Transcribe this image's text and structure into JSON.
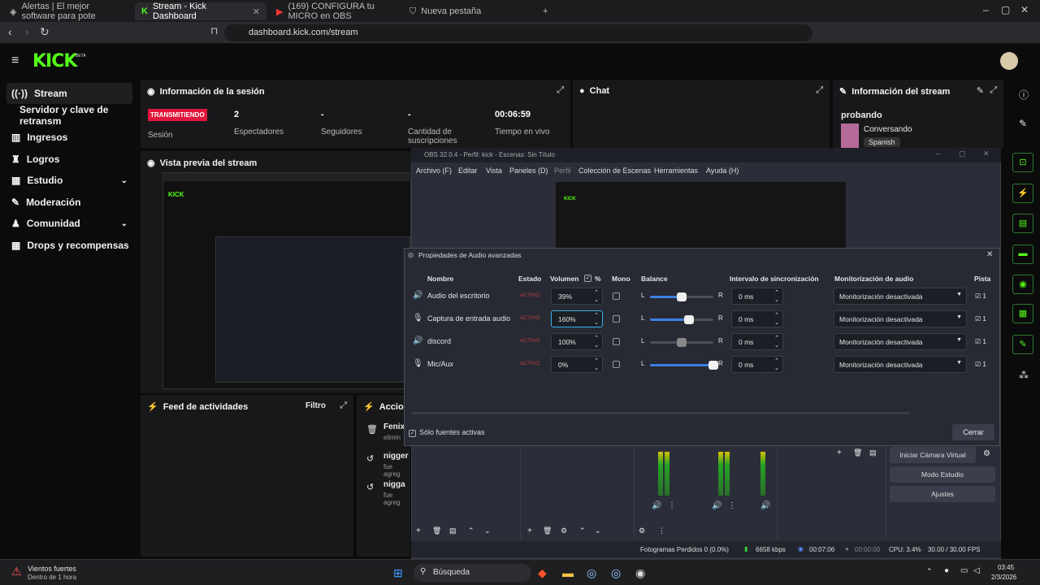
{
  "browser": {
    "tabs": [
      {
        "label": "Alertas | El mejor software para pote"
      },
      {
        "label": "Stream - Kick Dashboard"
      },
      {
        "label": "(169) CONFIGURA tu MICRO en OBS"
      },
      {
        "label": "Nueva pestaña"
      }
    ],
    "url": "dashboard.kick.com/stream"
  },
  "kick": {
    "logo": "KICK",
    "beta": "BETA"
  },
  "sidebar": {
    "items": [
      {
        "label": "Stream"
      },
      {
        "label": "Servidor y clave de retransm"
      },
      {
        "label": "Ingresos"
      },
      {
        "label": "Logros"
      },
      {
        "label": "Estudio"
      },
      {
        "label": "Moderación"
      },
      {
        "label": "Comunidad"
      },
      {
        "label": "Drops y recompensas"
      }
    ]
  },
  "session": {
    "title": "Información de la sesión",
    "live": "TRANSMITIENDO",
    "status": "Sesión",
    "viewers": "2",
    "viewers_label": "Espectadores",
    "followers": "-",
    "followers_label": "Seguidores",
    "subs": "-",
    "subs_label": "Cantidad de suscripciones",
    "time": "00:06:59",
    "time_label": "Tiempo en vivo"
  },
  "chat": {
    "title": "Chat"
  },
  "stream_info": {
    "title": "Información del stream",
    "name": "probando",
    "category": "Conversando",
    "language": "Spanish"
  },
  "preview": {
    "title": "Vista previa del stream"
  },
  "feed": {
    "title": "Feed de actividades",
    "filter": "Filtro"
  },
  "actions": {
    "title": "Acciones",
    "items": [
      {
        "name": "Fenix",
        "sub": "elimin"
      },
      {
        "name": "nigger",
        "sub": "fue agreg"
      },
      {
        "name": "nigga",
        "sub": "fue agreg"
      }
    ]
  },
  "obs": {
    "title": "OBS 32.0.4 - Perfil: kick - Escenas: Sin Título",
    "menu": [
      "Archivo (F)",
      "Editar",
      "Vista",
      "Paneles (D)",
      "Perfil",
      "Colección de Escenas",
      "Herramientas",
      "Ayuda (H)"
    ],
    "buttons": [
      "Iniciar Cámara Virtual",
      "Modo Estudio",
      "Ajustes"
    ],
    "status": {
      "dropped": "Fotogramas Perdidos 0 (0.0%)",
      "kbps": "6658 kbps",
      "rec": "00:07:06",
      "rec2": "00:00:00",
      "cpu": "CPU: 3.4%",
      "fps": "30.00 / 30.00 FPS"
    }
  },
  "dialog": {
    "title": "Propiedades de Audio avanzadas",
    "headers": {
      "name": "Nombre",
      "state": "Estado",
      "volume": "Volumen",
      "pct": "%",
      "mono": "Mono",
      "balance": "Balance",
      "sync": "Intervalo de sincronización",
      "monitor": "Monitorización de audio",
      "track": "Pista"
    },
    "rows": [
      {
        "name": "Audio del escritorio",
        "state": "ACTIVO",
        "volume": "39%",
        "sync": "0 ms",
        "monitor": "Monitorización desactivada",
        "balance": 0.5
      },
      {
        "name": "Captura de entrada audio",
        "state": "ACTIVO",
        "volume": "160%",
        "sync": "0 ms",
        "monitor": "Monitorización desactivada",
        "balance": 0.62
      },
      {
        "name": "discord",
        "state": "ACTIVO",
        "volume": "100%",
        "sync": "0 ms",
        "monitor": "Monitorización desactivada",
        "balance": 0.5
      },
      {
        "name": "Mic/Aux",
        "state": "ACTIVO",
        "volume": "0%",
        "sync": "0 ms",
        "monitor": "Monitorización desactivada",
        "balance": 1.0
      }
    ],
    "only_active": "Sólo fuentes activas",
    "close": "Cerrar",
    "track_label": "1"
  },
  "taskbar": {
    "weather": "Vientos fuertes",
    "weather_sub": "Dentro de 1 hora",
    "search": "Búsqueda",
    "time": "03:45",
    "date": "2/3/2026"
  },
  "colors": {
    "kick_green": "#53fc18",
    "live_red": "#e1143c"
  }
}
